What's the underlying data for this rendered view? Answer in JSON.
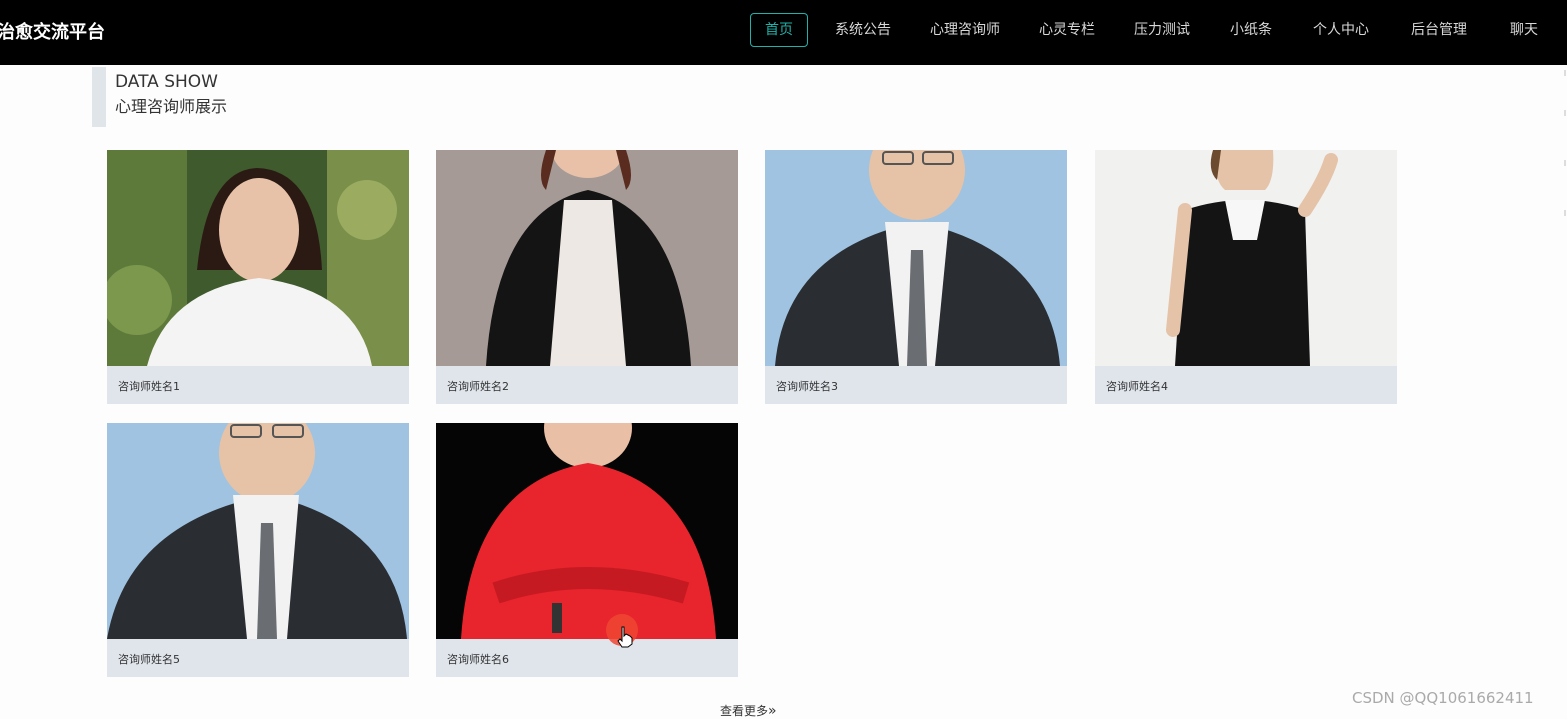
{
  "app": {
    "brand": "治愈交流平台"
  },
  "nav": {
    "items": [
      {
        "label": "首页",
        "active": true
      },
      {
        "label": "系统公告"
      },
      {
        "label": "心理咨询师"
      },
      {
        "label": "心灵专栏"
      },
      {
        "label": "压力测试"
      },
      {
        "label": "小纸条"
      },
      {
        "label": "个人中心"
      },
      {
        "label": "后台管理"
      },
      {
        "label": "聊天"
      }
    ]
  },
  "section": {
    "title_en": "DATA SHOW",
    "title_cn": "心理咨询师展示"
  },
  "counselors": [
    {
      "name": "咨询师姓名1"
    },
    {
      "name": "咨询师姓名2"
    },
    {
      "name": "咨询师姓名3"
    },
    {
      "name": "咨询师姓名4"
    },
    {
      "name": "咨询师姓名5"
    },
    {
      "name": "咨询师姓名6"
    }
  ],
  "more": {
    "label": "查看更多",
    "icon": "double-chevron-right-icon"
  },
  "watermark": "CSDN @QQ1061662411",
  "colors": {
    "accent": "#20b2aa",
    "topbar": "#000000",
    "card_bg": "#e0e5ec"
  }
}
